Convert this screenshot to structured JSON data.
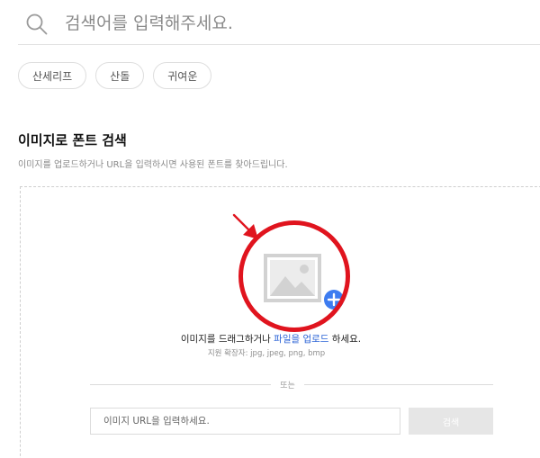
{
  "search": {
    "placeholder": "검색어를 입력해주세요.",
    "icon": "search-icon"
  },
  "tags": [
    {
      "label": "산세리프"
    },
    {
      "label": "산돌"
    },
    {
      "label": "귀여운"
    }
  ],
  "image_search": {
    "title": "이미지로 폰트 검색",
    "description": "이미지를 업로드하거나 URL을 입력하시면 사용된 폰트를 찾아드립니다.",
    "drop_prefix": "이미지를 드래그하거나 ",
    "upload_link": "파일을 업로드",
    "drop_suffix": " 하세요.",
    "formats": "지원 확장자: jpg, jpeg, png, bmp",
    "or_label": "또는",
    "url_placeholder": "이미지 URL을 입력하세요.",
    "search_button": "검색"
  },
  "colors": {
    "annotation": "#e0141e",
    "link": "#2a62d6",
    "upload_badge": "#3d7cf0"
  }
}
